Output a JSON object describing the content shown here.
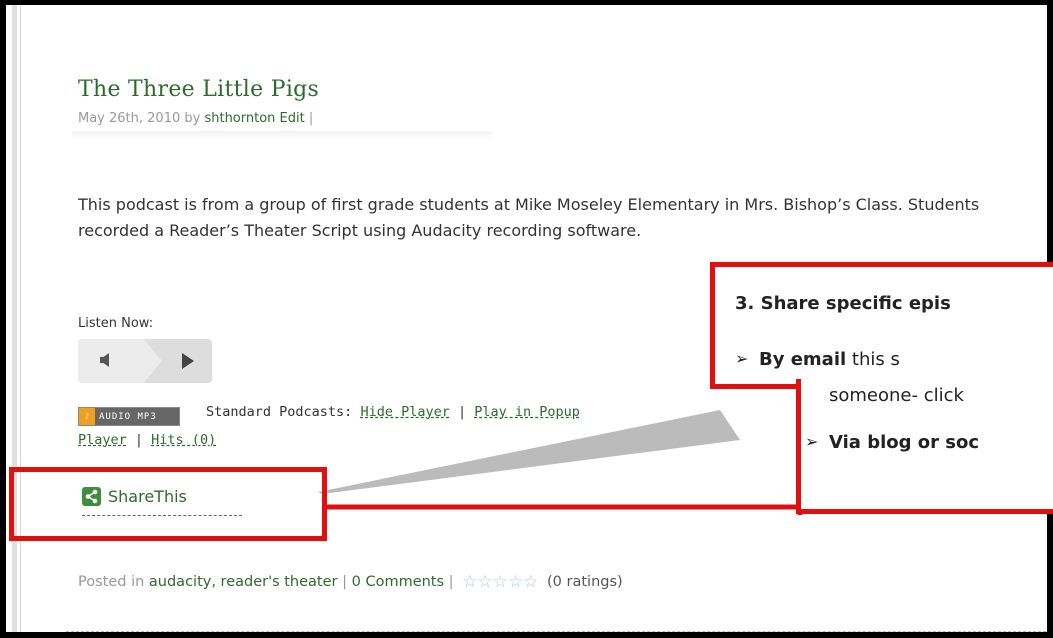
{
  "post": {
    "title": "The Three Little Pigs",
    "date": "May 26th, 2010 by ",
    "author": "shthornton",
    "edit": "Edit",
    "sep": " |",
    "body": "This podcast is from a group of first grade students at Mike Moseley Elementary in Mrs. Bishop’s Class.  Students recorded a Reader’s Theater Script using Audacity recording software."
  },
  "player": {
    "listen_label": "Listen Now:"
  },
  "podcasts": {
    "badge": "AUDIO MP3",
    "prefix": "Standard Podcasts: ",
    "hide_player": "Hide Player",
    "sep1": " | ",
    "play_popup": "Play in Popup",
    "player_link": "Player",
    "sep2": " | ",
    "hits": "Hits (0)"
  },
  "share": {
    "label": "ShareThis"
  },
  "footer": {
    "posted_in": "Posted in ",
    "categories": "audacity, reader's theater",
    "sep": " | ",
    "comments": "0 Comments",
    "sep2": " | ",
    "ratings": "(0 ratings)"
  },
  "callout": {
    "heading": "3. Share specific epis",
    "bullet1_bold": "By email",
    "bullet1_rest": " this s",
    "bullet1_line2": "someone- click",
    "bullet2_bold": "Via blog or soc",
    "arrow": "➢",
    "accent": "#e01010"
  }
}
